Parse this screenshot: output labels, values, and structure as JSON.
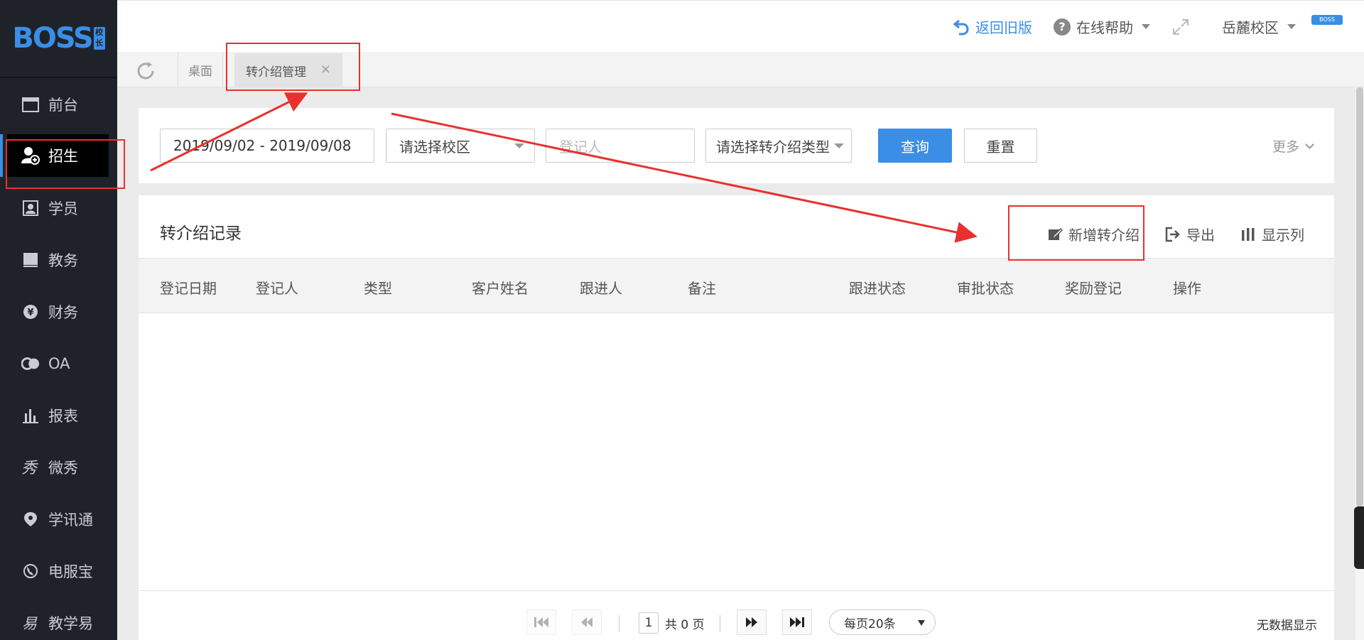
{
  "brand": {
    "logo_text": "BOSS",
    "logo_badge": "校长"
  },
  "sidebar": {
    "items": [
      {
        "label": "前台",
        "icon": "calendar-icon"
      },
      {
        "label": "招生",
        "icon": "add-user-icon"
      },
      {
        "label": "学员",
        "icon": "student-card-icon"
      },
      {
        "label": "教务",
        "icon": "book-icon"
      },
      {
        "label": "财务",
        "icon": "yen-icon"
      },
      {
        "label": "OA",
        "icon": "oa-icon"
      },
      {
        "label": "报表",
        "icon": "bar-chart-icon"
      },
      {
        "label": "微秀",
        "icon": "weixiu-icon"
      },
      {
        "label": "学讯通",
        "icon": "location-icon"
      },
      {
        "label": "电服宝",
        "icon": "phone-service-icon"
      },
      {
        "label": "教学易",
        "icon": "teach-icon"
      }
    ],
    "active_index": 1
  },
  "header": {
    "back_old": "返回旧版",
    "help": "在线帮助",
    "campus": "岳麓校区",
    "user_badge": "BOSS"
  },
  "tabs": {
    "desk": "桌面",
    "active": "转介绍管理",
    "close": "×"
  },
  "filters": {
    "date_range": "2019/09/02 - 2019/09/08",
    "campus_placeholder": "请选择校区",
    "registrar_placeholder": "登记人",
    "type_placeholder": "请选择转介绍类型",
    "query": "查询",
    "reset": "重置",
    "more": "更多"
  },
  "panel": {
    "title": "转介绍记录",
    "actions": {
      "add": "新增转介绍",
      "export": "导出",
      "columns": "显示列"
    },
    "columns": [
      "登记日期",
      "登记人",
      "类型",
      "客户姓名",
      "跟进人",
      "备注",
      "跟进状态",
      "审批状态",
      "奖励登记",
      "操作"
    ]
  },
  "pager": {
    "page": "1",
    "total": "共 0 页",
    "per_page": "每页20条",
    "no_data": "无数据显示"
  },
  "colors": {
    "accent": "#3a8ee6",
    "sidebar_bg": "#1f2329",
    "annotation": "#e8312f"
  }
}
